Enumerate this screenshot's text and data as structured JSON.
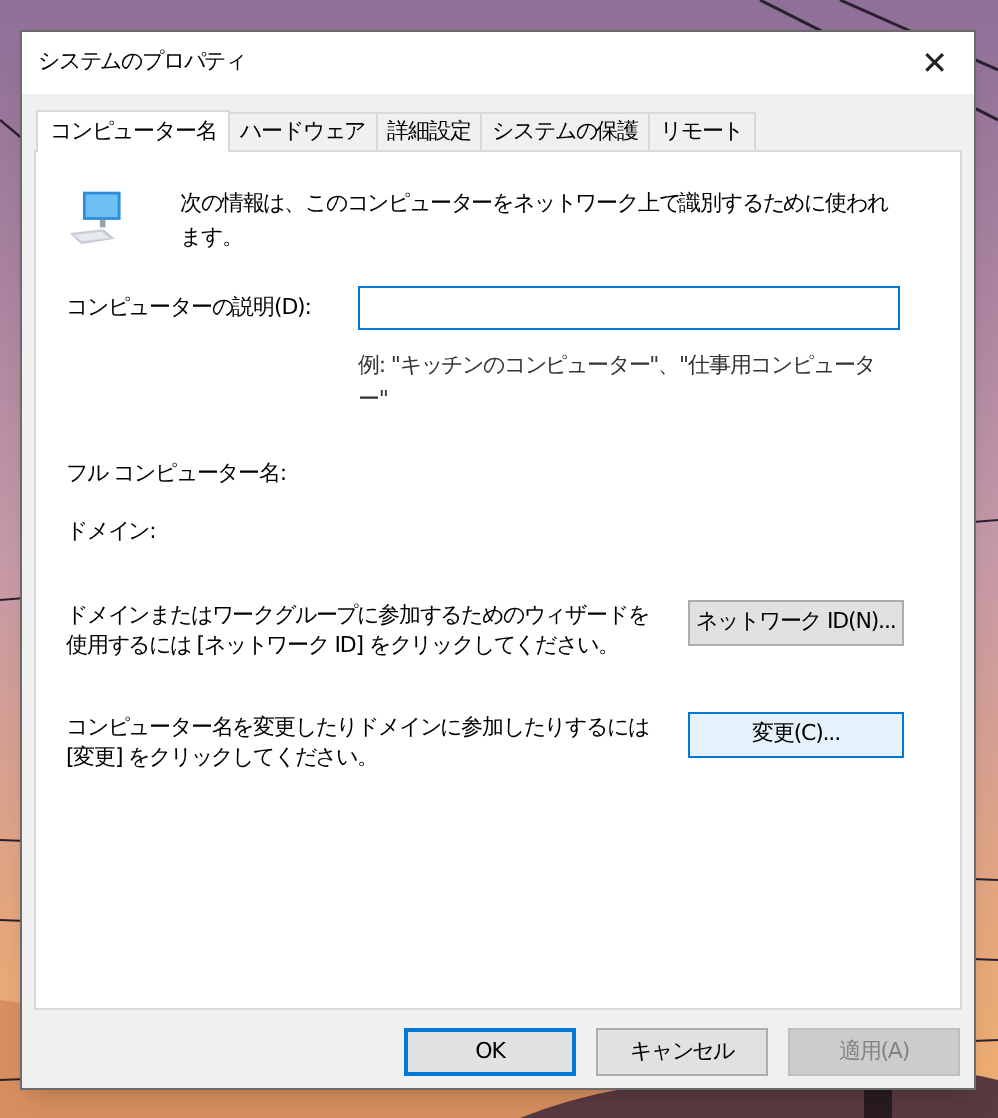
{
  "window": {
    "title": "システムのプロパティ",
    "close": "✕"
  },
  "tabs": [
    {
      "label": "コンピューター名",
      "selected": true
    },
    {
      "label": "ハードウェア",
      "selected": false
    },
    {
      "label": "詳細設定",
      "selected": false
    },
    {
      "label": "システムの保護",
      "selected": false
    },
    {
      "label": "リモート",
      "selected": false
    }
  ],
  "intro": "次の情報は、このコンピューターをネットワーク上で識別するために使われます。",
  "description": {
    "label": "コンピューターの説明(D):",
    "focused": true,
    "example": "例: \"キッチンのコンピューター\"、\"仕事用コンピューター\""
  },
  "full_name": {
    "label": "フル コンピューター名:"
  },
  "domain": {
    "label": "ドメイン:"
  },
  "actions": [
    {
      "text": "ドメインまたはワークグループに参加するためのウィザードを使用するには [ネットワーク ID] をクリックしてください。",
      "button": "ネットワーク ID(N)...",
      "highlighted": false
    },
    {
      "text": "コンピューター名を変更したりドメインに参加したりするには [変更] をクリックしてください。",
      "button": "変更(C)...",
      "highlighted": true
    }
  ],
  "buttons": [
    {
      "label": "OK",
      "default": true,
      "disabled": false
    },
    {
      "label": "キャンセル",
      "default": false,
      "disabled": false
    },
    {
      "label": "適用(A)",
      "default": false,
      "disabled": true
    }
  ]
}
